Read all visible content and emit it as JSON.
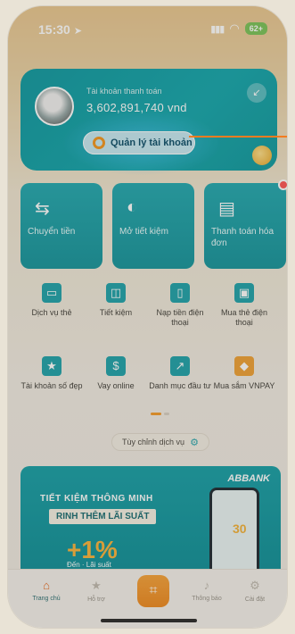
{
  "status": {
    "time": "15:30",
    "battery": "62+"
  },
  "account": {
    "label": "Tài khoản thanh toán",
    "balance": "3,602,891,740 vnd",
    "manage_label": "Quản lý tài khoản"
  },
  "quick_actions": [
    {
      "label": "Chuyển tiền",
      "icon": "transfer-icon"
    },
    {
      "label": "Mở tiết kiệm",
      "icon": "piggy-bank-icon"
    },
    {
      "label": "Thanh toán hóa đơn",
      "icon": "bill-icon"
    }
  ],
  "services": [
    {
      "label": "Dịch vụ thẻ",
      "icon": "card-icon",
      "color": "#1fa3ab"
    },
    {
      "label": "Tiết kiệm",
      "icon": "safe-icon",
      "color": "#1fa3ab"
    },
    {
      "label": "Nạp tiền điện thoại",
      "icon": "phone-topup-icon",
      "color": "#1fa3ab"
    },
    {
      "label": "Mua thẻ điện thoại",
      "icon": "phone-card-icon",
      "color": "#1fa3ab"
    },
    {
      "label": "Tài khoản số đẹp",
      "icon": "vip-account-icon",
      "color": "#1fa3ab"
    },
    {
      "label": "Vay online",
      "icon": "loan-icon",
      "color": "#1fa3ab"
    },
    {
      "label": "Danh mục đầu tư",
      "icon": "invest-chart-icon",
      "color": "#1fa3ab"
    },
    {
      "label": "Mua sắm VNPAY",
      "icon": "shopping-icon",
      "color": "#f0a236"
    }
  ],
  "customize_label": "Tùy chỉnh dịch vụ",
  "promo": {
    "brand": "ABBANK",
    "line1": "TIẾT KIỆM THÔNG MINH",
    "line2": "RINH THÊM LÃI SUẤT",
    "percent": "+1%",
    "upto": "Đến",
    "rate_word": "Lãi suất",
    "badge": "30"
  },
  "tabs": [
    {
      "label": "Trang chủ",
      "icon": "home-icon",
      "active": true
    },
    {
      "label": "Hỗ trợ",
      "icon": "support-star-icon",
      "active": false
    },
    {
      "label": "Thông báo",
      "icon": "bell-icon",
      "active": false
    },
    {
      "label": "Cài đặt",
      "icon": "settings-icon",
      "active": false
    }
  ],
  "colors": {
    "accent": "#16959d",
    "orange": "#f27c20"
  }
}
